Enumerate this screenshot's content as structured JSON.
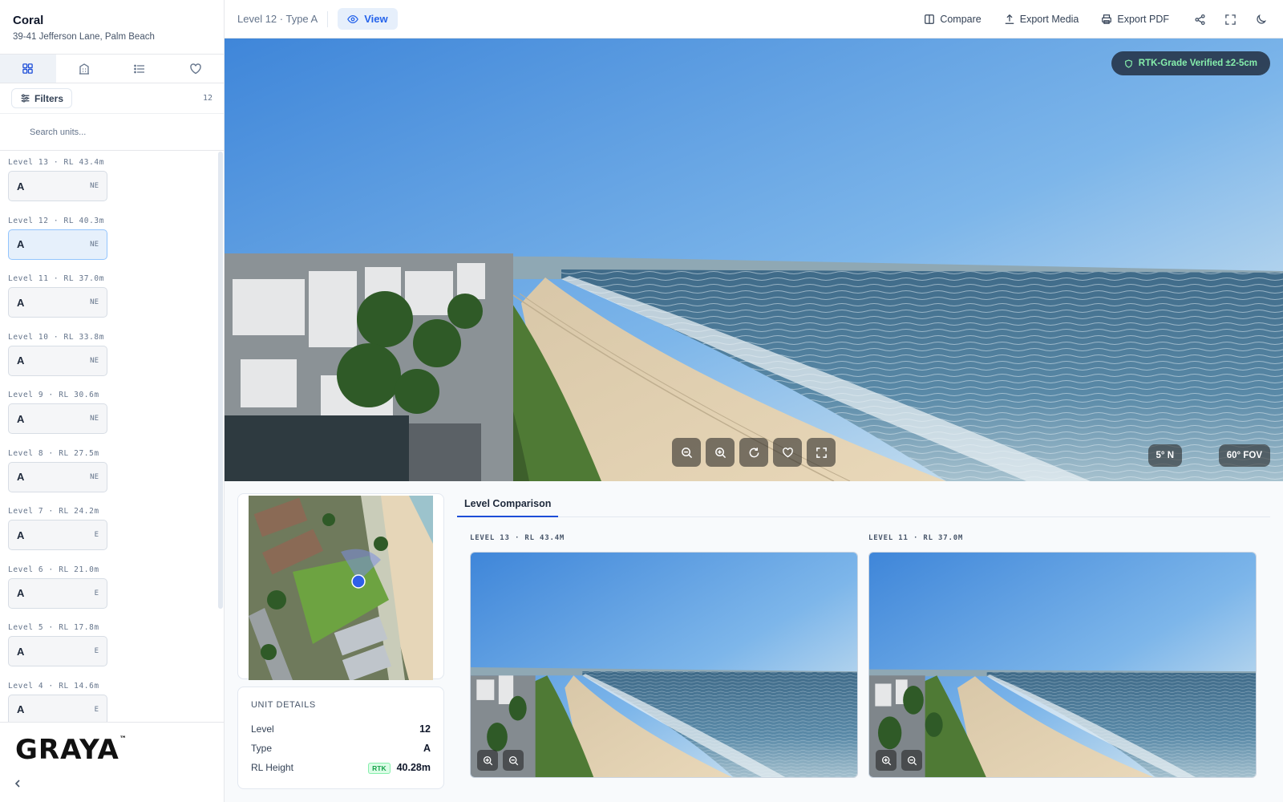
{
  "project": {
    "name": "Coral",
    "address": "39-41 Jefferson Lane, Palm Beach"
  },
  "sidebar": {
    "view_tabs": [
      {
        "icon": "grid-icon"
      },
      {
        "icon": "building-icon"
      },
      {
        "icon": "list-icon"
      },
      {
        "icon": "heart-icon"
      }
    ],
    "filters_label": "Filters",
    "unit_count": "12",
    "search_placeholder": "Search units...",
    "levels": [
      {
        "label": "Level 13 · RL 43.4m",
        "unit": "A",
        "orientation": "NE"
      },
      {
        "label": "Level 12 · RL 40.3m",
        "unit": "A",
        "orientation": "NE"
      },
      {
        "label": "Level 11 · RL 37.0m",
        "unit": "A",
        "orientation": "NE"
      },
      {
        "label": "Level 10 · RL 33.8m",
        "unit": "A",
        "orientation": "NE"
      },
      {
        "label": "Level 9 · RL 30.6m",
        "unit": "A",
        "orientation": "NE"
      },
      {
        "label": "Level 8 · RL 27.5m",
        "unit": "A",
        "orientation": "NE"
      },
      {
        "label": "Level 7 · RL 24.2m",
        "unit": "A",
        "orientation": "E"
      },
      {
        "label": "Level 6 · RL 21.0m",
        "unit": "A",
        "orientation": "E"
      },
      {
        "label": "Level 5 · RL 17.8m",
        "unit": "A",
        "orientation": "E"
      },
      {
        "label": "Level 4 · RL 14.6m",
        "unit": "A",
        "orientation": "E"
      }
    ],
    "selected_level_index": 1,
    "logo": "GRAYA",
    "logo_tm": "™"
  },
  "topbar": {
    "breadcrumb": "Level 12 · Type A",
    "view_label": "View",
    "compare_label": "Compare",
    "export_media_label": "Export Media",
    "export_pdf_label": "Export PDF"
  },
  "hero": {
    "verified_badge": "RTK-Grade Verified ±2-5cm",
    "heading": "5° N",
    "fov": "60° FOV"
  },
  "unit_details": {
    "title": "UNIT DETAILS",
    "level_label": "Level",
    "level_value": "12",
    "type_label": "Type",
    "type_value": "A",
    "rl_label": "RL Height",
    "rl_badge": "RTK",
    "rl_value": "40.28m"
  },
  "comparison": {
    "tab_label": "Level Comparison",
    "left_label": "LEVEL 13 · RL 43.4M",
    "right_label": "LEVEL 11 · RL 37.0M"
  },
  "colors": {
    "accent": "#2563eb",
    "verified_text": "#86efac",
    "selected_card": "#e6f0fb"
  }
}
